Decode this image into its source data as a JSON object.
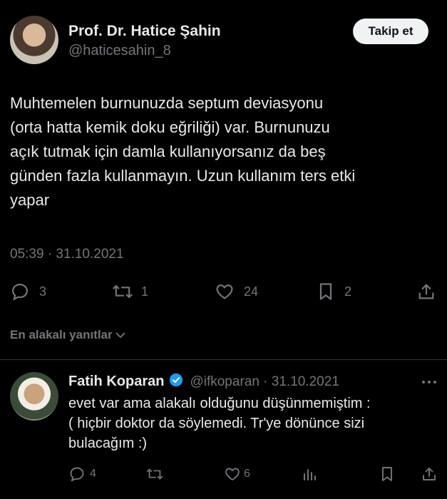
{
  "author": {
    "name": "Prof. Dr. Hatice Şahin",
    "handle": "@haticesahin_8",
    "follow_label": "Takip et"
  },
  "tweet": {
    "lines": [
      "Muhtemelen burnunuzda septum deviasyonu",
      "(orta hatta kemik doku eğriliği) var. Burnunuzu",
      "açık tutmak için damla kullanıyorsanız da beş",
      "günden fazla kullanmayın. Uzun kullanım ters etki",
      "yapar"
    ],
    "timestamp": "05:39 · 31.10.2021",
    "replies": "3",
    "retweets": "1",
    "likes": "24",
    "bookmarks": "2"
  },
  "replies_filter": {
    "label": "En alakalı yanıtlar"
  },
  "reply": {
    "name": "Fatih Koparan",
    "handle_date": "@ifkoparan · 31.10.2021",
    "lines": [
      "evet var ama alakalı olduğunu düşünmemiştim :",
      "( hiçbir doktor da söylemedi. Tr'ye dönünce sizi",
      "bulacağım :)"
    ],
    "replies": "4",
    "likes": "6"
  },
  "colors": {
    "background": "#000000",
    "text": "#e7e9ea",
    "muted": "#71767b",
    "verified": "#1d9bf0"
  }
}
